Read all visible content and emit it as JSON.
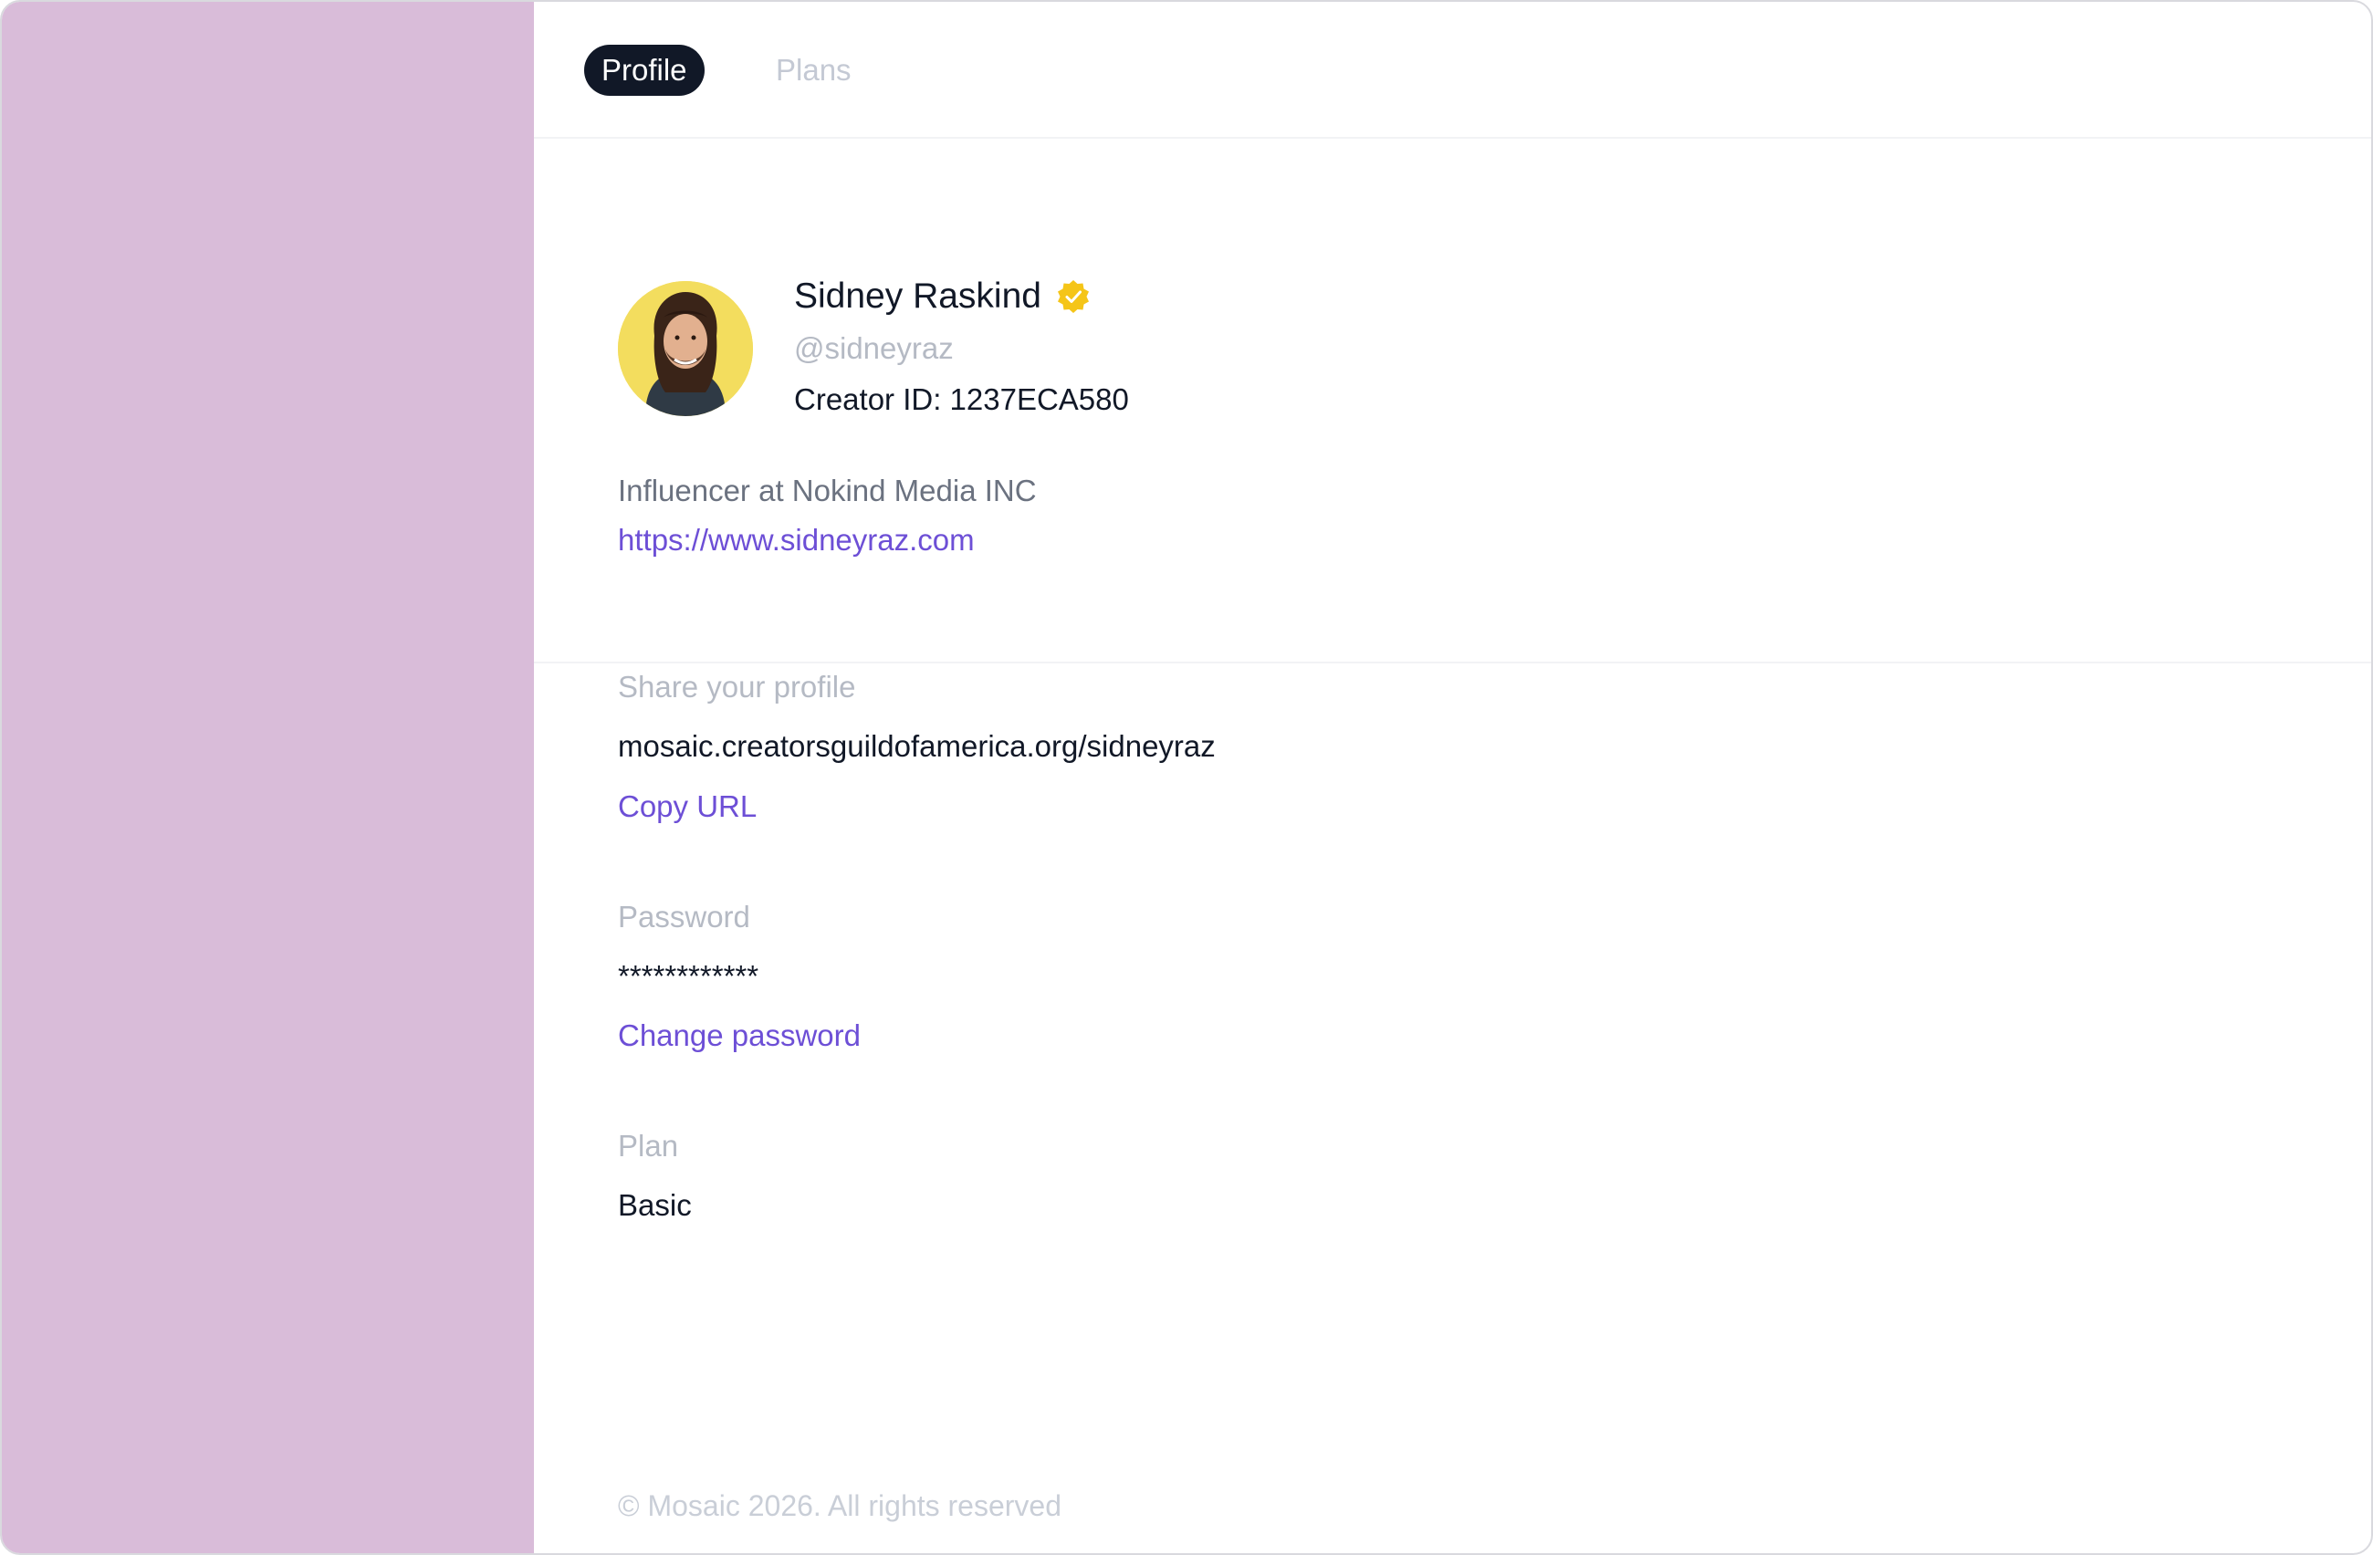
{
  "colors": {
    "sidebar_bg": "#d9bcd9",
    "active_tab_bg": "#111827",
    "link": "#6d4fd6",
    "verified_badge": "#f5c518"
  },
  "tabs": {
    "profile_label": "Profile",
    "plans_label": "Plans"
  },
  "profile": {
    "name": "Sidney Raskind",
    "verified_icon": "verified-badge-icon",
    "handle": "@sidneyraz",
    "creator_id": "Creator ID: 1237ECA580",
    "bio": "Influencer at Nokind Media INC",
    "website": "https://www.sidneyraz.com"
  },
  "share": {
    "label": "Share your profile",
    "url": "mosaic.creatorsguildofamerica.org/sidneyraz",
    "copy_label": "Copy URL"
  },
  "password": {
    "label": "Password",
    "value": "************",
    "change_label": "Change password"
  },
  "plan": {
    "label": "Plan",
    "value": "Basic"
  },
  "footer": {
    "text": "© Mosaic 2026. All rights reserved"
  }
}
